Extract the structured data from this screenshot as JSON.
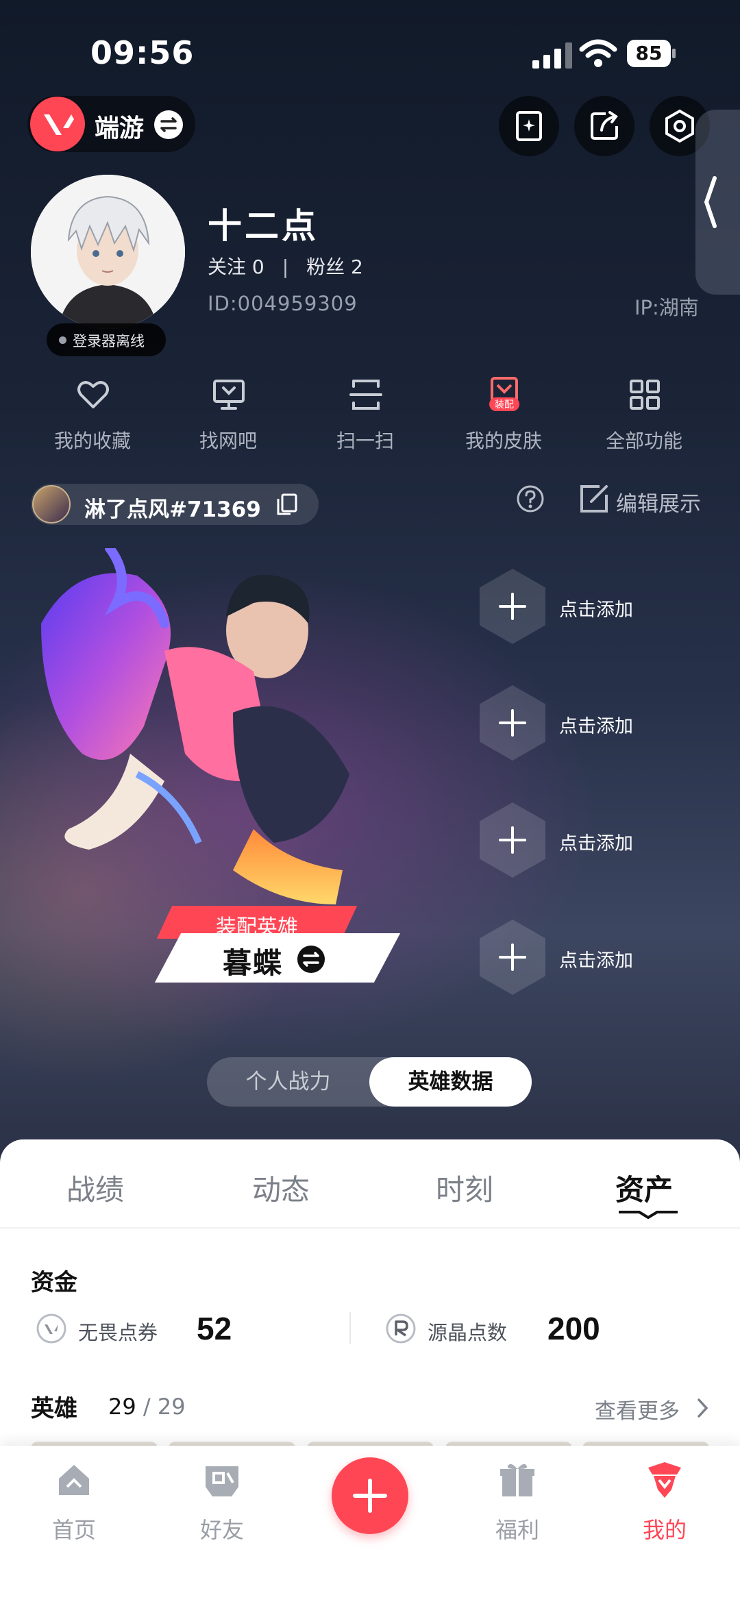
{
  "status_bar": {
    "time": "09:56",
    "battery": "85"
  },
  "header": {
    "game_name": "端游",
    "colors": {
      "brand": "#ff4655"
    }
  },
  "profile": {
    "username": "十二点",
    "follow_label": "关注 0",
    "fans_label": "粉丝 2",
    "separator": "|",
    "user_id": "ID:004959309",
    "ip": "IP:湖南",
    "online_status": "登录器离线"
  },
  "quick_actions": [
    {
      "label": "我的收藏",
      "icon": "heart-icon"
    },
    {
      "label": "找网吧",
      "icon": "monitor-icon"
    },
    {
      "label": "扫一扫",
      "icon": "scan-icon"
    },
    {
      "label": "我的皮肤",
      "icon": "skin-icon",
      "badge": "装配"
    },
    {
      "label": "全部功能",
      "icon": "grid-icon"
    }
  ],
  "game_account": {
    "name": "淋了点风#71369"
  },
  "showcase": {
    "edit_label": "编辑展示",
    "hero_badge": "装配英雄",
    "hero_name": "暮蝶",
    "slots": [
      "点击添加",
      "点击添加",
      "点击添加",
      "点击添加"
    ]
  },
  "toggle": {
    "left": "个人战力",
    "right": "英雄数据",
    "active": "right"
  },
  "tabs": [
    {
      "label": "战绩"
    },
    {
      "label": "动态"
    },
    {
      "label": "时刻"
    },
    {
      "label": "资产",
      "active": true
    }
  ],
  "funds": {
    "title": "资金",
    "items": [
      {
        "label": "无畏点券",
        "value": "52"
      },
      {
        "label": "源晶点数",
        "value": "200"
      }
    ]
  },
  "heroes": {
    "title": "英雄",
    "owned": "29",
    "total": "/ 29",
    "see_more": "查看更多"
  },
  "nav": [
    {
      "label": "首页",
      "icon": "home-icon"
    },
    {
      "label": "好友",
      "icon": "friends-icon"
    },
    {
      "label": "福利",
      "icon": "gift-icon"
    },
    {
      "label": "我的",
      "icon": "me-icon",
      "active": true
    }
  ]
}
